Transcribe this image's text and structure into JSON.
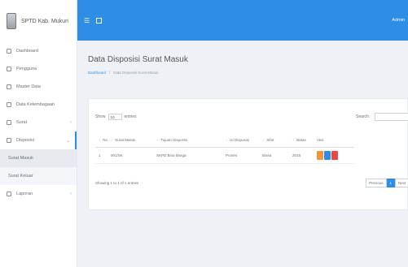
{
  "brand": {
    "title": "SPTD Kab. Mukuri"
  },
  "topbar": {
    "user": "Admin"
  },
  "sidebar": {
    "items": [
      {
        "label": "Dashboard",
        "icon": "home-icon"
      },
      {
        "label": "Pengguna",
        "icon": "user-icon"
      },
      {
        "label": "Master Data",
        "icon": "database-icon"
      },
      {
        "label": "Data Kelembagaan",
        "icon": "building-icon"
      },
      {
        "label": "Surat",
        "icon": "mail-icon"
      },
      {
        "label": "Disposisi",
        "icon": "share-icon"
      }
    ],
    "submenu": [
      "Surat Masuk",
      "Surat Keluar"
    ],
    "last_item": {
      "label": "Laporan",
      "icon": "report-icon"
    }
  },
  "page": {
    "title": "Data Disposisi Surat Masuk",
    "breadcrumb": [
      "Dashboard",
      "Data Disposisi Surat Masuk"
    ]
  },
  "table_controls": {
    "show_label": "Show",
    "entries_value": "10",
    "entries_label": "entries",
    "search_label": "Search:",
    "search_value": ""
  },
  "table": {
    "headers": [
      "No",
      "Surat Masuk",
      "Tujuan Disposisi",
      "Isi Disposisi",
      "Sifat",
      "Batas",
      "Aksi"
    ],
    "rows": [
      [
        "1",
        "001/SK",
        "SKPD Bina Marga",
        "Proses",
        "Biasa",
        "2018"
      ]
    ]
  },
  "footer": {
    "showing": "Showing 1 to 1 of 1 entries",
    "pagination": [
      "Previous",
      "1",
      "Next"
    ]
  }
}
